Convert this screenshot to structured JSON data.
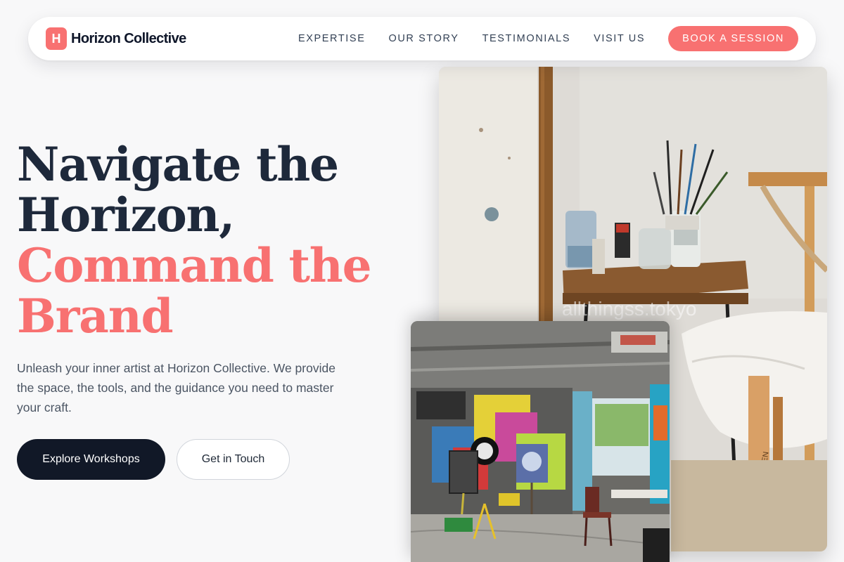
{
  "brand": {
    "logo_letter": "H",
    "name": "Horizon Collective",
    "accent_color": "#f87171",
    "dark_color": "#111827"
  },
  "nav": {
    "links": [
      "EXPERTISE",
      "OUR STORY",
      "TESTIMONIALS",
      "VISIT US"
    ],
    "cta_label": "BOOK A SESSION"
  },
  "hero": {
    "title_line1": "Navigate the",
    "title_line2": "Horizon,",
    "title_line3": "Command the",
    "title_line4": "Brand",
    "subtitle": "Unleash your inner artist at Horizon Collective. We provide the space, the tools, and the guidance you need to master your craft.",
    "primary_button": "Explore Workshops",
    "secondary_button": "Get in Touch"
  },
  "images": {
    "main_watermark": "allthingss.tokyo",
    "easel_text": "MEEDEN"
  }
}
